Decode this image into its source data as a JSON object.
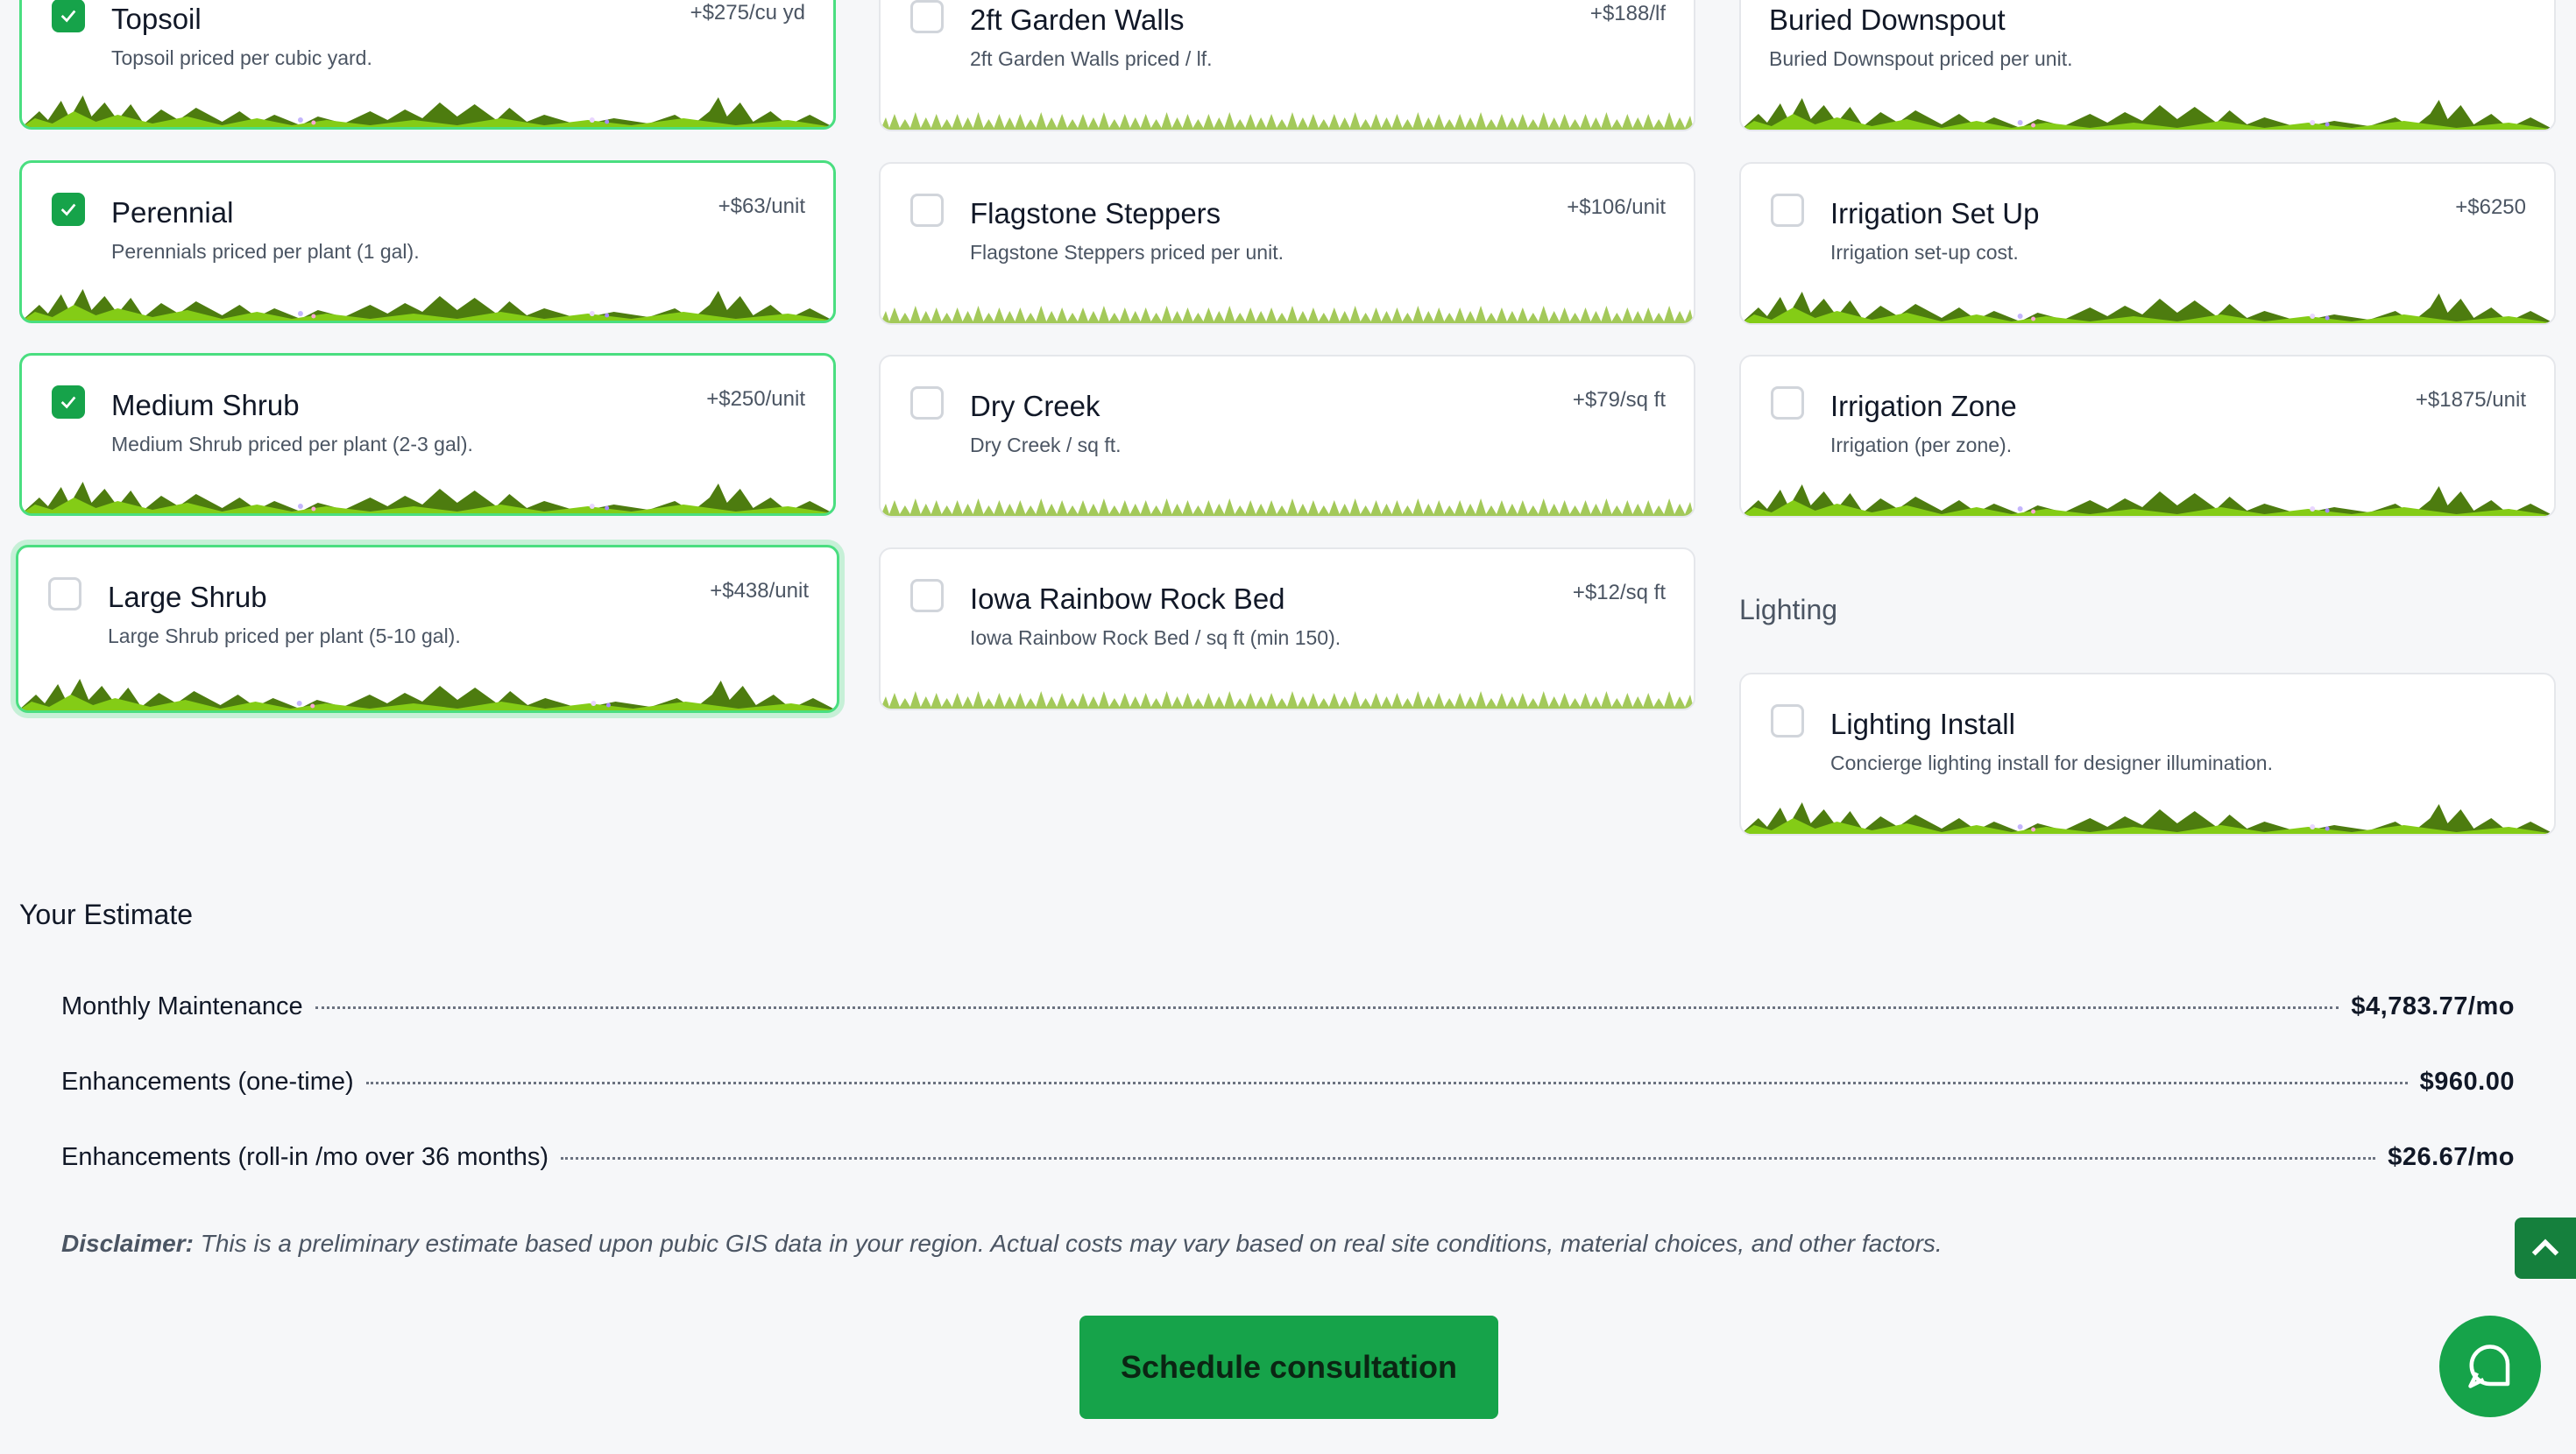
{
  "colors": {
    "accent": "#16a34a",
    "selected_border": "#4ade80",
    "grass": "#65a30d"
  },
  "options": [
    {
      "title": "Topsoil",
      "description": "Topsoil priced per cubic yard.",
      "price": "+$275/cu yd",
      "checked": true
    },
    {
      "title": "Perennial",
      "description": "Perennials priced per plant (1 gal).",
      "price": "+$63/unit",
      "checked": true
    },
    {
      "title": "Medium Shrub",
      "description": "Medium Shrub priced per plant (2-3 gal).",
      "price": "+$250/unit",
      "checked": true
    },
    {
      "title": "Large Shrub",
      "description": "Large Shrub priced per plant (5-10 gal).",
      "price": "+$438/unit",
      "checked": false
    },
    {
      "title": "2ft Garden Walls",
      "description": "2ft Garden Walls priced / lf.",
      "price": "+$188/lf",
      "checked": false
    },
    {
      "title": "Flagstone Steppers",
      "description": "Flagstone Steppers priced per unit.",
      "price": "+$106/unit",
      "checked": false
    },
    {
      "title": "Dry Creek",
      "description": "Dry Creek / sq ft.",
      "price": "+$79/sq ft",
      "checked": false
    },
    {
      "title": "Iowa Rainbow Rock Bed",
      "description": "Iowa Rainbow Rock Bed / sq ft (min 150).",
      "price": "+$12/sq ft",
      "checked": false
    },
    {
      "title": "Buried Downspout",
      "description": "Buried Downspout priced per unit.",
      "price": "",
      "checked": false,
      "icon": "chevron-down-icon"
    },
    {
      "title": "Irrigation Set Up",
      "description": "Irrigation set-up cost.",
      "price": "+$6250",
      "checked": false
    },
    {
      "title": "Irrigation Zone",
      "description": "Irrigation (per zone).",
      "price": "+$1875/unit",
      "checked": false
    },
    {
      "title": "Lighting Install",
      "description": "Concierge lighting install for designer illumination.",
      "price": "",
      "checked": false
    }
  ],
  "lighting_section": {
    "heading": "Lighting"
  },
  "estimate": {
    "title": "Your Estimate",
    "rows": [
      {
        "label": "Monthly Maintenance",
        "amount": "$4,783.77/mo"
      },
      {
        "label": "Enhancements (one-time)",
        "amount": "$960.00"
      },
      {
        "label": "Enhancements (roll-in /mo over 36 months)",
        "amount": "$26.67/mo"
      }
    ],
    "disclaimer_label": "Disclaimer:",
    "disclaimer_text": " This is a preliminary estimate based upon pubic GIS data in your region. Actual costs may vary based on real site conditions, material choices, and other factors."
  },
  "cta": {
    "label": "Schedule consultation"
  },
  "floating": {
    "scroll_top_icon": "chevron-up-icon",
    "chat_icon": "chat-bubble-icon"
  }
}
